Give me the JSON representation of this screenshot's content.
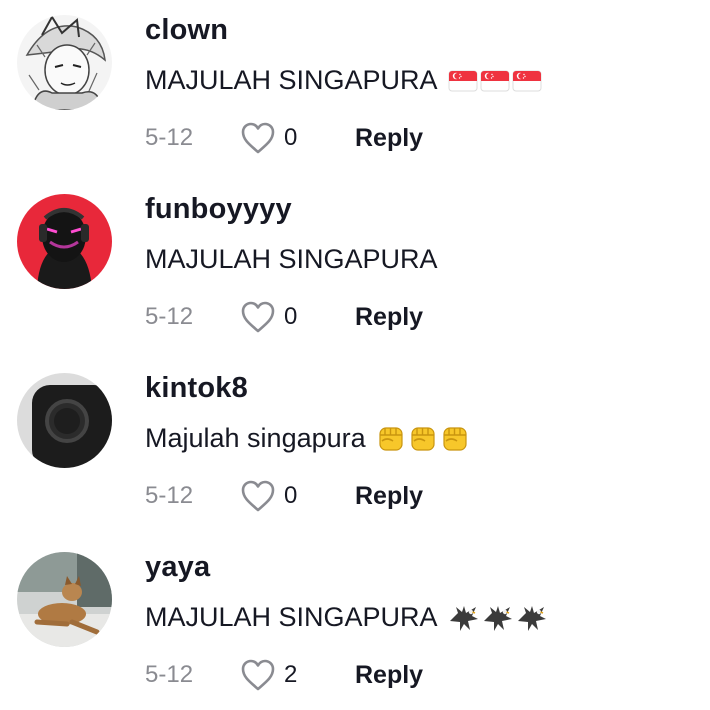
{
  "comments": [
    {
      "username": "clown",
      "text": "MAJULAH SINGAPURA",
      "emoji_name": "singapore-flag-icon",
      "emoji_count": 3,
      "date": "5-12",
      "likes": "0",
      "reply_label": "Reply"
    },
    {
      "username": "funboyyyy",
      "text": "MAJULAH SINGAPURA",
      "emoji_name": "",
      "emoji_count": 0,
      "date": "5-12",
      "likes": "0",
      "reply_label": "Reply"
    },
    {
      "username": "kintok8",
      "text": "Majulah singapura",
      "emoji_name": "raised-fist-icon",
      "emoji_count": 3,
      "date": "5-12",
      "likes": "0",
      "reply_label": "Reply"
    },
    {
      "username": "yaya",
      "text": "MAJULAH SINGAPURA",
      "emoji_name": "eagle-icon",
      "emoji_count": 3,
      "date": "5-12",
      "likes": "2",
      "reply_label": "Reply"
    }
  ],
  "colors": {
    "text": "#161823",
    "muted": "#8a8b91",
    "heart_outline": "#8a8b91",
    "flag_red": "#ef3340",
    "fist_yellow": "#f7c72a"
  }
}
